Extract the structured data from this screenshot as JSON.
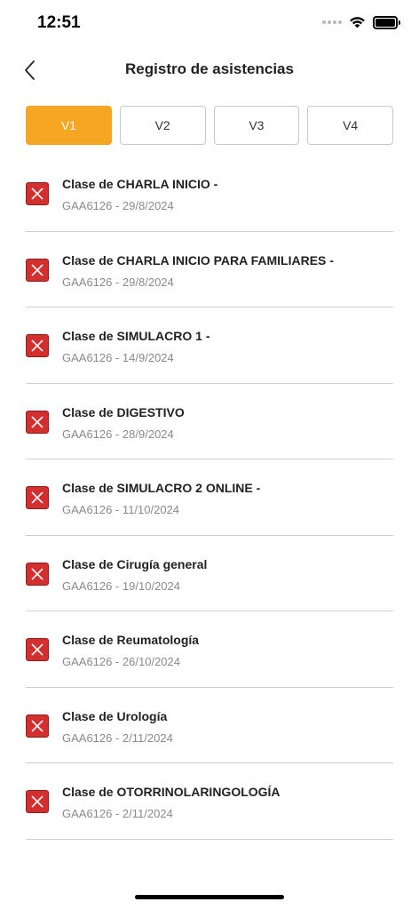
{
  "status_bar": {
    "time": "12:51",
    "icons": [
      "signal-dots-icon",
      "wifi-icon",
      "battery-icon"
    ],
    "battery_level": 1.0
  },
  "nav": {
    "back_icon": "chevron-left-icon",
    "title": "Registro de asistencias"
  },
  "tabs": [
    {
      "label": "V1",
      "active": true
    },
    {
      "label": "V2",
      "active": false
    },
    {
      "label": "V3",
      "active": false
    },
    {
      "label": "V4",
      "active": false
    }
  ],
  "colors": {
    "accent": "#f5a623",
    "absent": "#d32f2f",
    "subtitle": "#8a8a8a"
  },
  "attendance": [
    {
      "title": "Clase de CHARLA INICIO -",
      "subtitle": "GAA6126 - 29/8/2024",
      "status_icon": "close-icon"
    },
    {
      "title": "Clase de CHARLA INICIO PARA FAMILIARES -",
      "subtitle": "GAA6126 - 29/8/2024",
      "status_icon": "close-icon"
    },
    {
      "title": "Clase de SIMULACRO 1 -",
      "subtitle": "GAA6126 - 14/9/2024",
      "status_icon": "close-icon"
    },
    {
      "title": "Clase de DIGESTIVO",
      "subtitle": "GAA6126 - 28/9/2024",
      "status_icon": "close-icon"
    },
    {
      "title": "Clase de SIMULACRO 2 ONLINE -",
      "subtitle": "GAA6126 - 11/10/2024",
      "status_icon": "close-icon"
    },
    {
      "title": "Clase de Cirugía general",
      "subtitle": "GAA6126 - 19/10/2024",
      "status_icon": "close-icon"
    },
    {
      "title": "Clase de Reumatología",
      "subtitle": "GAA6126 - 26/10/2024",
      "status_icon": "close-icon"
    },
    {
      "title": "Clase de Urología",
      "subtitle": "GAA6126 - 2/11/2024",
      "status_icon": "close-icon"
    },
    {
      "title": "Clase de OTORRINOLARINGOLOGÍA",
      "subtitle": "GAA6126 - 2/11/2024",
      "status_icon": "close-icon"
    }
  ]
}
